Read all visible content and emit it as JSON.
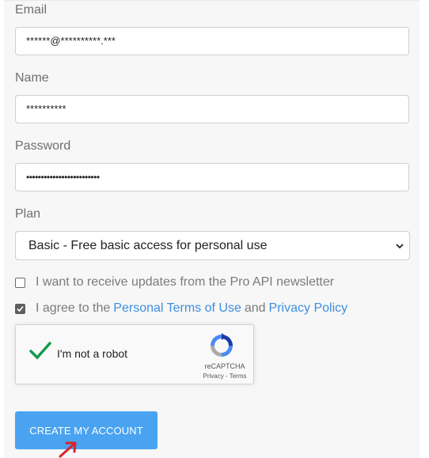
{
  "form": {
    "email": {
      "label": "Email",
      "value": "******@**********.***"
    },
    "name": {
      "label": "Name",
      "value": "**********"
    },
    "password": {
      "label": "Password",
      "value": "•••••••••••••••••••••••••"
    },
    "plan": {
      "label": "Plan",
      "selected": "Basic - Free basic access for personal use"
    },
    "newsletter": {
      "label": "I want to receive updates from the Pro API newsletter",
      "checked": false
    },
    "terms": {
      "prefix": "I agree to the",
      "terms_link": "Personal Terms of Use",
      "conjunction": "and",
      "privacy_link": "Privacy Policy",
      "checked": true
    },
    "recaptcha": {
      "label": "I'm not a robot",
      "brand": "reCAPTCHA",
      "links": "Privacy - Terms",
      "verified": true
    },
    "submit_label": "CREATE MY ACCOUNT"
  },
  "colors": {
    "accent": "#49a3f1",
    "link": "#3d8ee0",
    "check_green": "#109b4c",
    "annotation_arrow": "#e0202a"
  },
  "icons": [
    "chevron-down-icon",
    "checkmark-icon",
    "recaptcha-logo-icon",
    "red-arrow-icon"
  ]
}
